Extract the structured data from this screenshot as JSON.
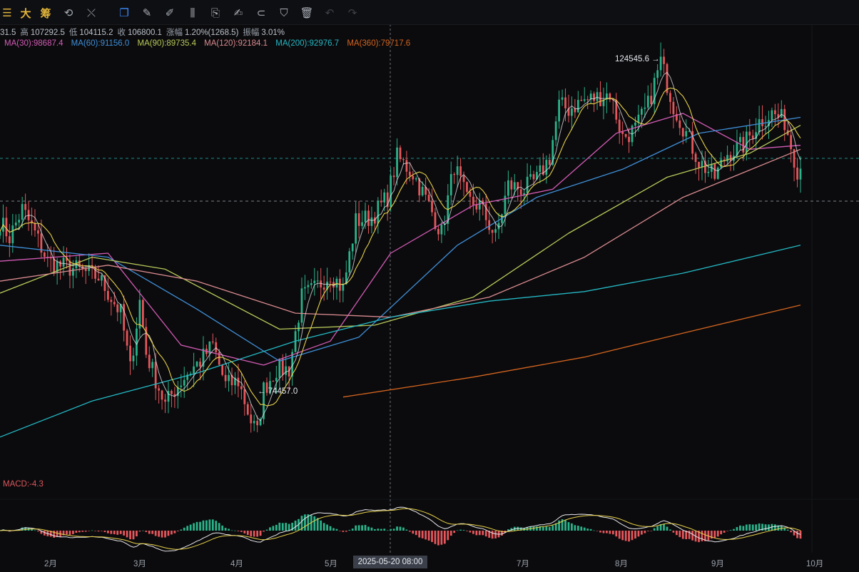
{
  "toolbar": {
    "items": [
      {
        "name": "menu-icon",
        "label": "☰",
        "cls": "txt"
      },
      {
        "name": "tool-da",
        "label": "大",
        "cls": "txt"
      },
      {
        "name": "tool-chou",
        "label": "筹",
        "cls": "txt"
      },
      {
        "name": "sync-icon",
        "label": "⟲",
        "cls": ""
      },
      {
        "name": "indicator-icon",
        "label": "⤬",
        "cls": ""
      },
      {
        "name": "copy-icon",
        "label": "❐",
        "cls": "active"
      },
      {
        "name": "ruler-icon",
        "label": "✎",
        "cls": ""
      },
      {
        "name": "pen-icon",
        "label": "✐",
        "cls": ""
      },
      {
        "name": "candles-icon",
        "label": "⫼",
        "cls": ""
      },
      {
        "name": "clipboard-icon",
        "label": "⎘",
        "cls": ""
      },
      {
        "name": "edit-icon",
        "label": "✍",
        "cls": ""
      },
      {
        "name": "magnet-icon",
        "label": "⊂",
        "cls": ""
      },
      {
        "name": "filter-icon",
        "label": "⛉",
        "cls": ""
      },
      {
        "name": "trash-icon",
        "label": "🗑",
        "cls": ""
      },
      {
        "name": "undo-icon",
        "label": "↶",
        "cls": "dim"
      },
      {
        "name": "redo-icon",
        "label": "↷",
        "cls": "dim"
      }
    ]
  },
  "ohlc": {
    "open_partial": "31.5",
    "high_label": "高",
    "high": "107292.5",
    "low_label": "低",
    "low": "104115.2",
    "close_label": "收",
    "close": "106800.1",
    "change_label": "涨幅",
    "change": "1.20%(1268.5)",
    "amp_label": "振幅",
    "amp": "3.01%"
  },
  "ma": [
    {
      "label": "MA(30):98687.4",
      "color": "#d45bb6"
    },
    {
      "label": "MA(60):91156.0",
      "color": "#3f8fd8"
    },
    {
      "label": "MA(90):89735.4",
      "color": "#b8c95a"
    },
    {
      "label": "MA(120):92184.1",
      "color": "#d98a8f"
    },
    {
      "label": "MA(200):92976.7",
      "color": "#24b8c4"
    },
    {
      "label": "MA(360):79717.6",
      "color": "#d4641f"
    }
  ],
  "annotations": {
    "high": "124545.6 →",
    "low": "← 74457.0"
  },
  "macd_label": "MACD:-4.3",
  "crosshair_label": "2025-05-20 08:00",
  "x_axis": [
    "2月",
    "3月",
    "4月",
    "5月",
    "7月",
    "8月",
    "9月",
    "10月"
  ],
  "chart_data": {
    "type": "candlestick",
    "x_range": [
      "2025-01-17",
      "2025-09-26"
    ],
    "y_range": [
      70000,
      128000
    ],
    "high_marker": 124545.6,
    "low_marker": 74457.0,
    "close_path": [
      [
        "2025-01-17",
        103000
      ],
      [
        "2025-01-20",
        101000
      ],
      [
        "2025-01-24",
        104500
      ],
      [
        "2025-01-28",
        101500
      ],
      [
        "2025-02-01",
        98000
      ],
      [
        "2025-02-04",
        97500
      ],
      [
        "2025-02-10",
        97000
      ],
      [
        "2025-02-17",
        96000
      ],
      [
        "2025-02-24",
        91500
      ],
      [
        "2025-02-27",
        84500
      ],
      [
        "2025-03-02",
        93000
      ],
      [
        "2025-03-04",
        86500
      ],
      [
        "2025-03-10",
        80000
      ],
      [
        "2025-03-13",
        82000
      ],
      [
        "2025-03-17",
        84000
      ],
      [
        "2025-03-21",
        85500
      ],
      [
        "2025-03-25",
        87500
      ],
      [
        "2025-03-29",
        82500
      ],
      [
        "2025-04-02",
        83000
      ],
      [
        "2025-04-06",
        78000
      ],
      [
        "2025-04-08",
        76500
      ],
      [
        "2025-04-10",
        82000
      ],
      [
        "2025-04-14",
        84500
      ],
      [
        "2025-04-18",
        84500
      ],
      [
        "2025-04-22",
        93500
      ],
      [
        "2025-04-26",
        94500
      ],
      [
        "2025-05-01",
        96500
      ],
      [
        "2025-05-05",
        94500
      ],
      [
        "2025-05-09",
        103000
      ],
      [
        "2025-05-14",
        103500
      ],
      [
        "2025-05-19",
        106000
      ],
      [
        "2025-05-22",
        111000
      ],
      [
        "2025-05-27",
        109000
      ],
      [
        "2025-06-01",
        105000
      ],
      [
        "2025-06-05",
        101500
      ],
      [
        "2025-06-09",
        110000
      ],
      [
        "2025-06-13",
        105500
      ],
      [
        "2025-06-17",
        105000
      ],
      [
        "2025-06-22",
        101000
      ],
      [
        "2025-06-26",
        107500
      ],
      [
        "2025-07-01",
        107000
      ],
      [
        "2025-07-05",
        108200
      ],
      [
        "2025-07-09",
        111000
      ],
      [
        "2025-07-12",
        117500
      ],
      [
        "2025-07-15",
        117000
      ],
      [
        "2025-07-19",
        118000
      ],
      [
        "2025-07-24",
        118500
      ],
      [
        "2025-07-28",
        119000
      ],
      [
        "2025-08-01",
        113500
      ],
      [
        "2025-08-05",
        114500
      ],
      [
        "2025-08-09",
        117500
      ],
      [
        "2025-08-13",
        123000
      ],
      [
        "2025-08-17",
        117500
      ],
      [
        "2025-08-21",
        114000
      ],
      [
        "2025-08-25",
        110500
      ],
      [
        "2025-08-30",
        108500
      ],
      [
        "2025-09-03",
        111500
      ],
      [
        "2025-09-08",
        112500
      ],
      [
        "2025-09-13",
        115500
      ],
      [
        "2025-09-17",
        116500
      ],
      [
        "2025-09-21",
        115500
      ],
      [
        "2025-09-25",
        109500
      ],
      [
        "2025-09-26",
        109800
      ]
    ],
    "ma_lines": [
      {
        "name": "MA(30)",
        "color": "#d45bb6",
        "points": [
          [
            "2025-01-17",
            98000
          ],
          [
            "2025-02-20",
            99000
          ],
          [
            "2025-03-15",
            87500
          ],
          [
            "2025-04-10",
            85000
          ],
          [
            "2025-05-01",
            88000
          ],
          [
            "2025-05-20",
            99000
          ],
          [
            "2025-06-15",
            105000
          ],
          [
            "2025-07-10",
            107000
          ],
          [
            "2025-07-30",
            114000
          ],
          [
            "2025-08-20",
            116500
          ],
          [
            "2025-09-10",
            112000
          ],
          [
            "2025-09-26",
            112500
          ]
        ]
      },
      {
        "name": "MA(60)",
        "color": "#3f8fd8",
        "points": [
          [
            "2025-01-17",
            100000
          ],
          [
            "2025-02-20",
            98500
          ],
          [
            "2025-03-20",
            92000
          ],
          [
            "2025-04-15",
            85500
          ],
          [
            "2025-05-10",
            88500
          ],
          [
            "2025-06-10",
            100000
          ],
          [
            "2025-07-05",
            106000
          ],
          [
            "2025-08-01",
            109500
          ],
          [
            "2025-08-25",
            114000
          ],
          [
            "2025-09-26",
            116000
          ]
        ]
      },
      {
        "name": "MA(90)",
        "color": "#b8c95a",
        "points": [
          [
            "2025-01-17",
            94000
          ],
          [
            "2025-02-15",
            98500
          ],
          [
            "2025-03-10",
            97000
          ],
          [
            "2025-04-15",
            89500
          ],
          [
            "2025-05-15",
            90000
          ],
          [
            "2025-06-15",
            93500
          ],
          [
            "2025-07-15",
            101500
          ],
          [
            "2025-08-15",
            108500
          ],
          [
            "2025-09-10",
            111500
          ],
          [
            "2025-09-26",
            115000
          ]
        ]
      },
      {
        "name": "MA(120)",
        "color": "#d98a8f",
        "points": [
          [
            "2025-01-17",
            95500
          ],
          [
            "2025-02-20",
            97500
          ],
          [
            "2025-03-20",
            95500
          ],
          [
            "2025-04-20",
            91500
          ],
          [
            "2025-05-20",
            91000
          ],
          [
            "2025-06-20",
            93500
          ],
          [
            "2025-07-20",
            98500
          ],
          [
            "2025-08-20",
            106000
          ],
          [
            "2025-09-26",
            112000
          ]
        ]
      },
      {
        "name": "MA(200)",
        "color": "#24b8c4",
        "points": [
          [
            "2025-01-17",
            76000
          ],
          [
            "2025-02-15",
            80500
          ],
          [
            "2025-03-20",
            84000
          ],
          [
            "2025-04-20",
            88000
          ],
          [
            "2025-05-20",
            91000
          ],
          [
            "2025-06-20",
            93000
          ],
          [
            "2025-07-20",
            94200
          ],
          [
            "2025-08-20",
            96500
          ],
          [
            "2025-09-26",
            100000
          ]
        ]
      },
      {
        "name": "MA(360)",
        "color": "#d4641f",
        "points": [
          [
            "2025-05-05",
            81000
          ],
          [
            "2025-06-15",
            83500
          ],
          [
            "2025-07-20",
            86000
          ],
          [
            "2025-08-20",
            89000
          ],
          [
            "2025-09-26",
            92500
          ]
        ]
      }
    ]
  }
}
